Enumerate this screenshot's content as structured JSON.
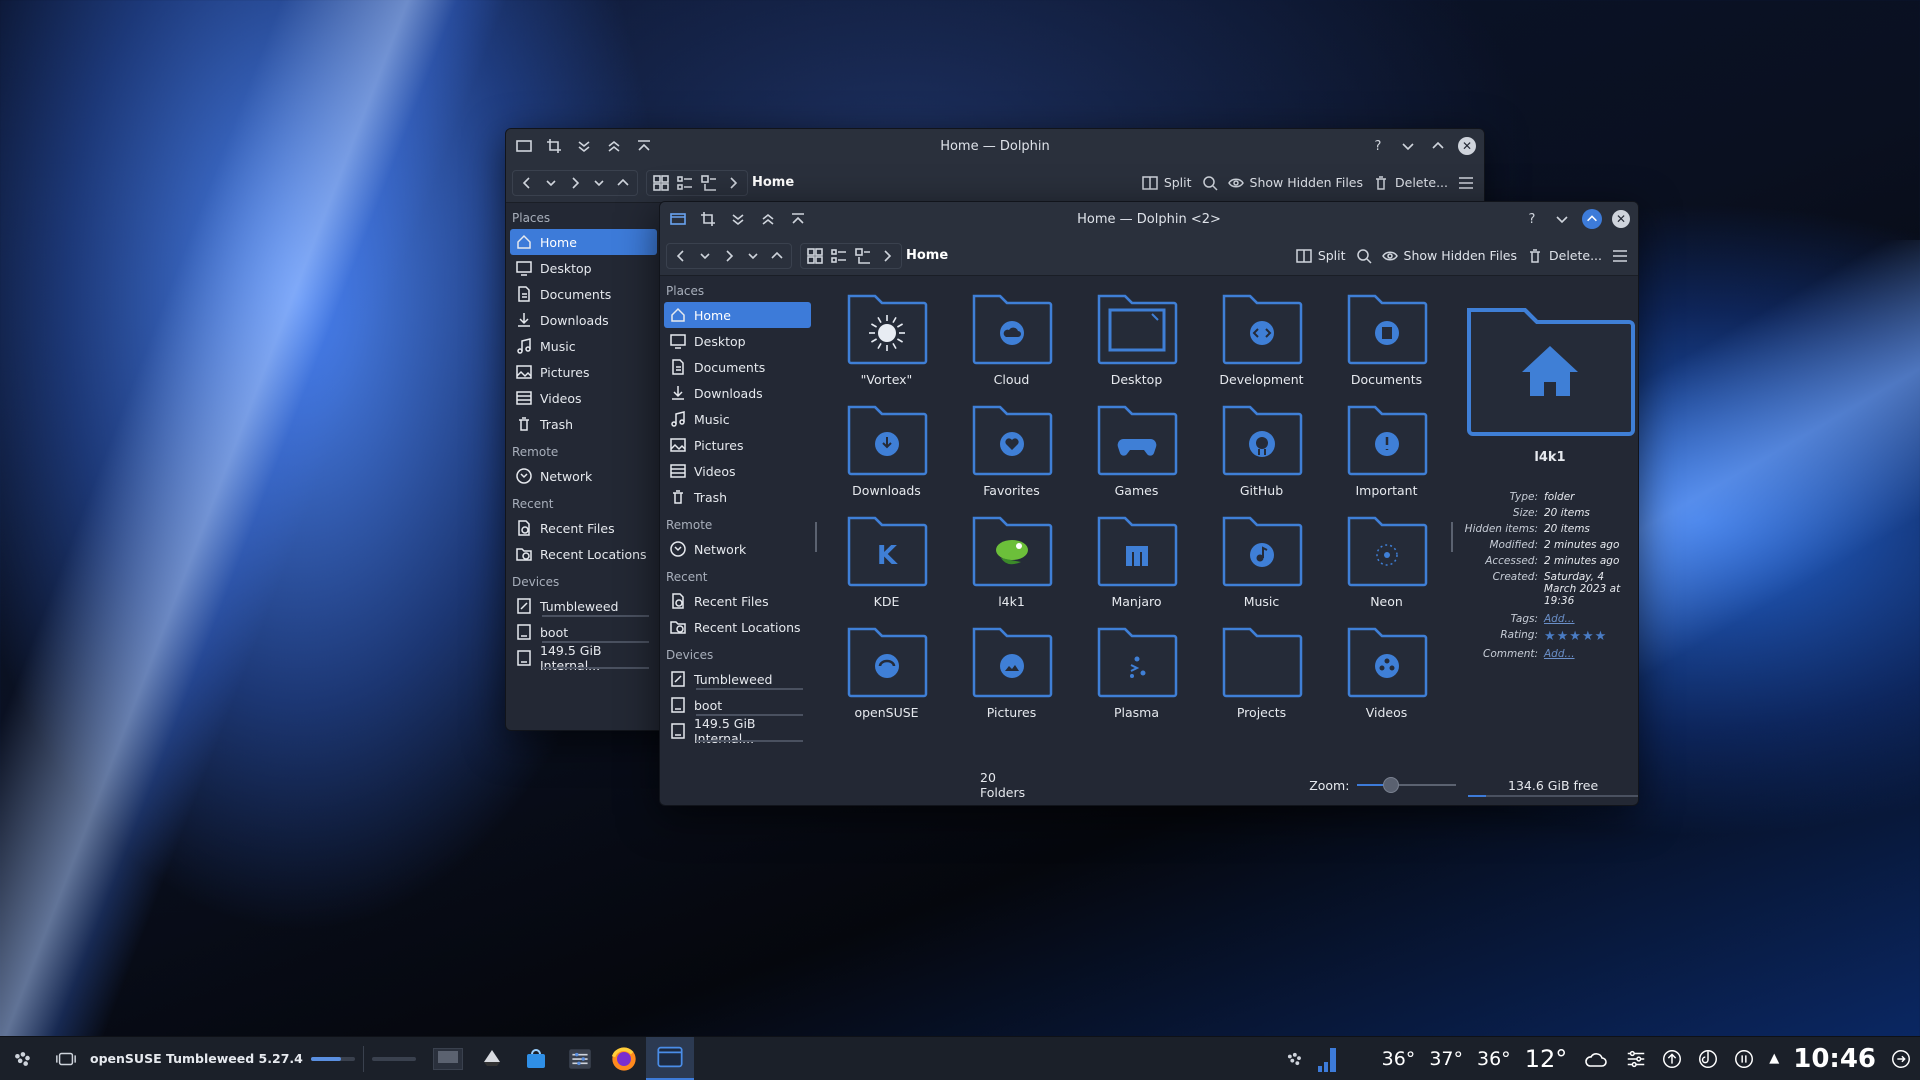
{
  "back_window": {
    "title": "Home — Dolphin",
    "breadcrumb": "Home",
    "toolbar": {
      "split": "Split",
      "show_hidden": "Show Hidden Files",
      "delete": "Delete..."
    },
    "sections": [
      {
        "title": "Places",
        "items": [
          "Home",
          "Desktop",
          "Documents",
          "Downloads",
          "Music",
          "Pictures",
          "Videos",
          "Trash"
        ]
      },
      {
        "title": "Remote",
        "items": [
          "Network"
        ]
      },
      {
        "title": "Recent",
        "items": [
          "Recent Files",
          "Recent Locations"
        ]
      },
      {
        "title": "Devices",
        "items": [
          "Tumbleweed",
          "boot",
          "149.5 GiB Internal..."
        ]
      }
    ]
  },
  "front_window": {
    "title": "Home — Dolphin <2>",
    "breadcrumb": "Home",
    "toolbar": {
      "split": "Split",
      "show_hidden": "Show Hidden Files",
      "delete": "Delete..."
    },
    "sections": [
      {
        "title": "Places",
        "items": [
          "Home",
          "Desktop",
          "Documents",
          "Downloads",
          "Music",
          "Pictures",
          "Videos",
          "Trash"
        ]
      },
      {
        "title": "Remote",
        "items": [
          "Network"
        ]
      },
      {
        "title": "Recent",
        "items": [
          "Recent Files",
          "Recent Locations"
        ]
      },
      {
        "title": "Devices",
        "items": [
          "Tumbleweed",
          "boot",
          "149.5 GiB Internal..."
        ]
      }
    ],
    "folders": [
      "\"Vortex\"",
      "Cloud",
      "Desktop",
      "Development",
      "Documents",
      "Downloads",
      "Favorites",
      "Games",
      "GitHub",
      "Important",
      "KDE",
      "l4k1",
      "Manjaro",
      "Music",
      "Neon",
      "openSUSE",
      "Pictures",
      "Plasma",
      "Projects",
      "Videos"
    ],
    "info_panel": {
      "name": "l4k1",
      "rows": [
        {
          "k": "Type:",
          "v": "folder"
        },
        {
          "k": "Size:",
          "v": "20 items"
        },
        {
          "k": "Hidden items:",
          "v": "20 items"
        },
        {
          "k": "Modified:",
          "v": "2 minutes ago"
        },
        {
          "k": "Accessed:",
          "v": "2 minutes ago"
        },
        {
          "k": "Created:",
          "v": "Saturday, 4 March 2023 at 19:36"
        }
      ],
      "tags_label": "Tags:",
      "tags_value": "Add...",
      "rating_label": "Rating:",
      "comment_label": "Comment:",
      "comment_value": "Add..."
    },
    "status": {
      "folders": "20 Folders",
      "zoom_label": "Zoom:",
      "free": "134.6 GiB free"
    }
  },
  "taskbar": {
    "distro": "openSUSE Tumbleweed 5.27.4",
    "temps": [
      "36°",
      "37°",
      "36°"
    ],
    "weather": "12°",
    "clock": "10:46"
  },
  "colors": {
    "accent": "#3d7bd9",
    "folder": "#3f7fd6"
  }
}
